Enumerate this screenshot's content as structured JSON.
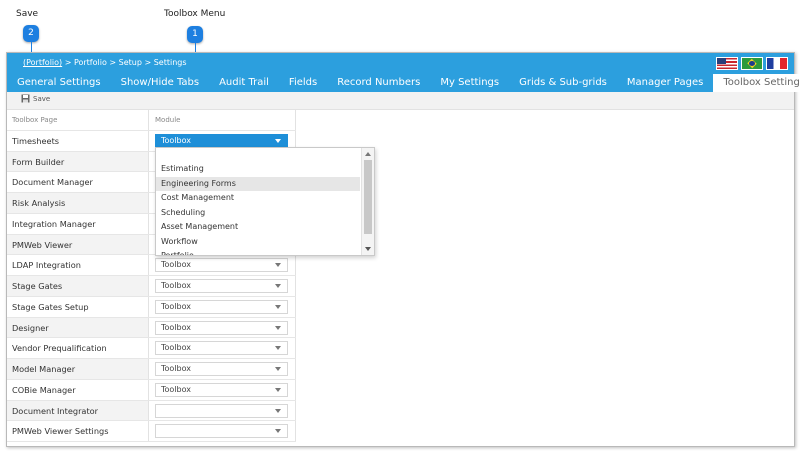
{
  "callouts": {
    "save": {
      "label": "Save",
      "number": "2"
    },
    "toolbox_menu": {
      "label": "Toolbox Menu",
      "number": "1"
    }
  },
  "breadcrumb": {
    "link": "(Portfolio)",
    "rest": " > Portfolio > Setup > Settings"
  },
  "flags": [
    "us-flag-icon",
    "brazil-flag-icon",
    "france-flag-icon"
  ],
  "tabs": [
    {
      "label": "General Settings"
    },
    {
      "label": "Show/Hide Tabs"
    },
    {
      "label": "Audit Trail"
    },
    {
      "label": "Fields"
    },
    {
      "label": "Record Numbers"
    },
    {
      "label": "My Settings"
    },
    {
      "label": "Grids & Sub-grids"
    },
    {
      "label": "Manager Pages"
    },
    {
      "label": "Toolbox Settings",
      "active": true
    }
  ],
  "toolbar": {
    "save_label": "Save"
  },
  "grid": {
    "headers": {
      "page": "Toolbox Page",
      "module": "Module"
    },
    "rows": [
      {
        "page": "Timesheets",
        "module": "Toolbox"
      },
      {
        "page": "Form Builder",
        "module": ""
      },
      {
        "page": "Document Manager",
        "module": ""
      },
      {
        "page": "Risk Analysis",
        "module": ""
      },
      {
        "page": "Integration Manager",
        "module": ""
      },
      {
        "page": "PMWeb Viewer",
        "module": ""
      },
      {
        "page": "LDAP Integration",
        "module": "Toolbox"
      },
      {
        "page": "Stage Gates",
        "module": "Toolbox"
      },
      {
        "page": "Stage Gates Setup",
        "module": "Toolbox"
      },
      {
        "page": "Designer",
        "module": "Toolbox"
      },
      {
        "page": "Vendor Prequalification",
        "module": "Toolbox"
      },
      {
        "page": "Model Manager",
        "module": "Toolbox"
      },
      {
        "page": "COBie Manager",
        "module": "Toolbox"
      },
      {
        "page": "Document Integrator",
        "module": ""
      },
      {
        "page": "PMWeb Viewer Settings",
        "module": ""
      }
    ]
  },
  "dropdown": {
    "options": [
      "Estimating",
      "Engineering Forms",
      "Cost Management",
      "Scheduling",
      "Asset Management",
      "Workflow",
      "Portfolio"
    ],
    "highlighted": "Engineering Forms"
  },
  "colors": {
    "accent": "#2c9fde",
    "selected": "#1e8fd8",
    "callout": "#1d7fe0"
  }
}
